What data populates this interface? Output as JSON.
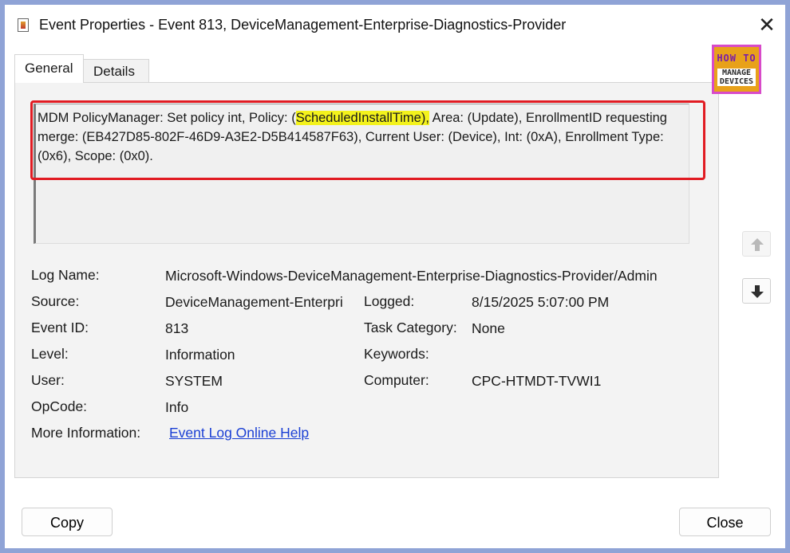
{
  "window": {
    "title": "Event Properties - Event 813, DeviceManagement-Enterprise-Diagnostics-Provider",
    "close_glyph": "✕"
  },
  "tabs": [
    {
      "label": "General",
      "selected": true
    },
    {
      "label": "Details",
      "selected": false
    }
  ],
  "description": {
    "before": "MDM PolicyManager: Set policy int, Policy: (",
    "highlight": "ScheduledInstallTime),",
    "after": " Area: (Update), EnrollmentID requesting merge: (EB427D85-802F-46D9-A3E2-D5B414587F63), Current User: (Device), Int: (0xA), Enrollment Type: (0x6), Scope: (0x0).",
    "highlight_color": "#f3f21c",
    "callout_color": "#e11b22"
  },
  "logo": {
    "line1": "HOW TO",
    "line2": "MANAGE",
    "line3": "DEVICES"
  },
  "icons": {
    "scroll_up": "arrow-up-icon",
    "scroll_down": "arrow-down-icon"
  },
  "fields": {
    "log_name": {
      "label": "Log Name:",
      "value": "Microsoft-Windows-DeviceManagement-Enterprise-Diagnostics-Provider/Admin"
    },
    "source": {
      "label": "Source:",
      "value": "DeviceManagement-Enterpri"
    },
    "logged": {
      "label": "Logged:",
      "value": "8/15/2025 5:07:00 PM"
    },
    "event_id": {
      "label": "Event ID:",
      "value": "813"
    },
    "task_category": {
      "label": "Task Category:",
      "value": "None"
    },
    "level": {
      "label": "Level:",
      "value": "Information"
    },
    "keywords": {
      "label": "Keywords:",
      "value": ""
    },
    "user": {
      "label": "User:",
      "value": "SYSTEM"
    },
    "computer": {
      "label": "Computer:",
      "value": "CPC-HTMDT-TVWI1"
    },
    "opcode": {
      "label": "OpCode:",
      "value": "Info"
    },
    "more_info": {
      "label": "More Information:",
      "link": "Event Log Online Help"
    }
  },
  "buttons": {
    "copy": "Copy",
    "close": "Close"
  }
}
